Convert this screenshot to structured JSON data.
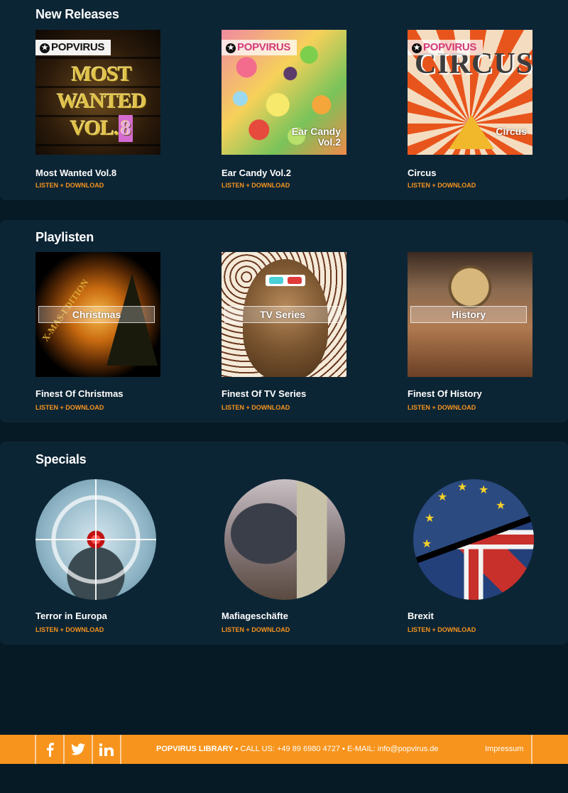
{
  "sections": {
    "new_releases": {
      "title": "New Releases",
      "items": [
        {
          "title": "Most Wanted Vol.8",
          "link": "LISTEN + DOWNLOAD",
          "cover_logo": "POPVIRUS",
          "cover_text": "MOST WANTED VOL.8"
        },
        {
          "title": "Ear Candy Vol.2",
          "link": "LISTEN + DOWNLOAD",
          "cover_logo": "POPVIRUS",
          "cover_caption_1": "Ear Candy",
          "cover_caption_2": "Vol.2"
        },
        {
          "title": "Circus",
          "link": "LISTEN + DOWNLOAD",
          "cover_logo": "POPVIRUS",
          "cover_word": "CIRCUS",
          "cover_caption_1": "Circus"
        }
      ]
    },
    "playlisten": {
      "title": "Playlisten",
      "items": [
        {
          "title": "Finest Of Christmas",
          "link": "LISTEN + DOWNLOAD",
          "cover_band": "Christmas",
          "cover_arc": "X-MAS-EDITION"
        },
        {
          "title": "Finest Of TV Series",
          "link": "LISTEN + DOWNLOAD",
          "cover_band": "TV Series"
        },
        {
          "title": "Finest Of History",
          "link": "LISTEN + DOWNLOAD",
          "cover_band": "History"
        }
      ]
    },
    "specials": {
      "title": "Specials",
      "items": [
        {
          "title": "Terror in Europa",
          "link": "LISTEN + DOWNLOAD"
        },
        {
          "title": "Mafiageschäfte",
          "link": "LISTEN + DOWNLOAD"
        },
        {
          "title": "Brexit",
          "link": "LISTEN + DOWNLOAD"
        }
      ]
    }
  },
  "footer": {
    "social": [
      {
        "icon": "facebook-icon"
      },
      {
        "icon": "twitter-icon"
      },
      {
        "icon": "linkedin-icon"
      }
    ],
    "brand": "POPVIRUS LIBRARY",
    "separator": " ▪ ",
    "call_label": "CALL US: +49 89 6980 4727",
    "email_label": "E-MAIL: info@popvirus.de",
    "impressum": "Impressum"
  },
  "colors": {
    "background": "#061a26",
    "panel": "#0c2535",
    "accent": "#f7941d",
    "text": "#ffffff"
  }
}
